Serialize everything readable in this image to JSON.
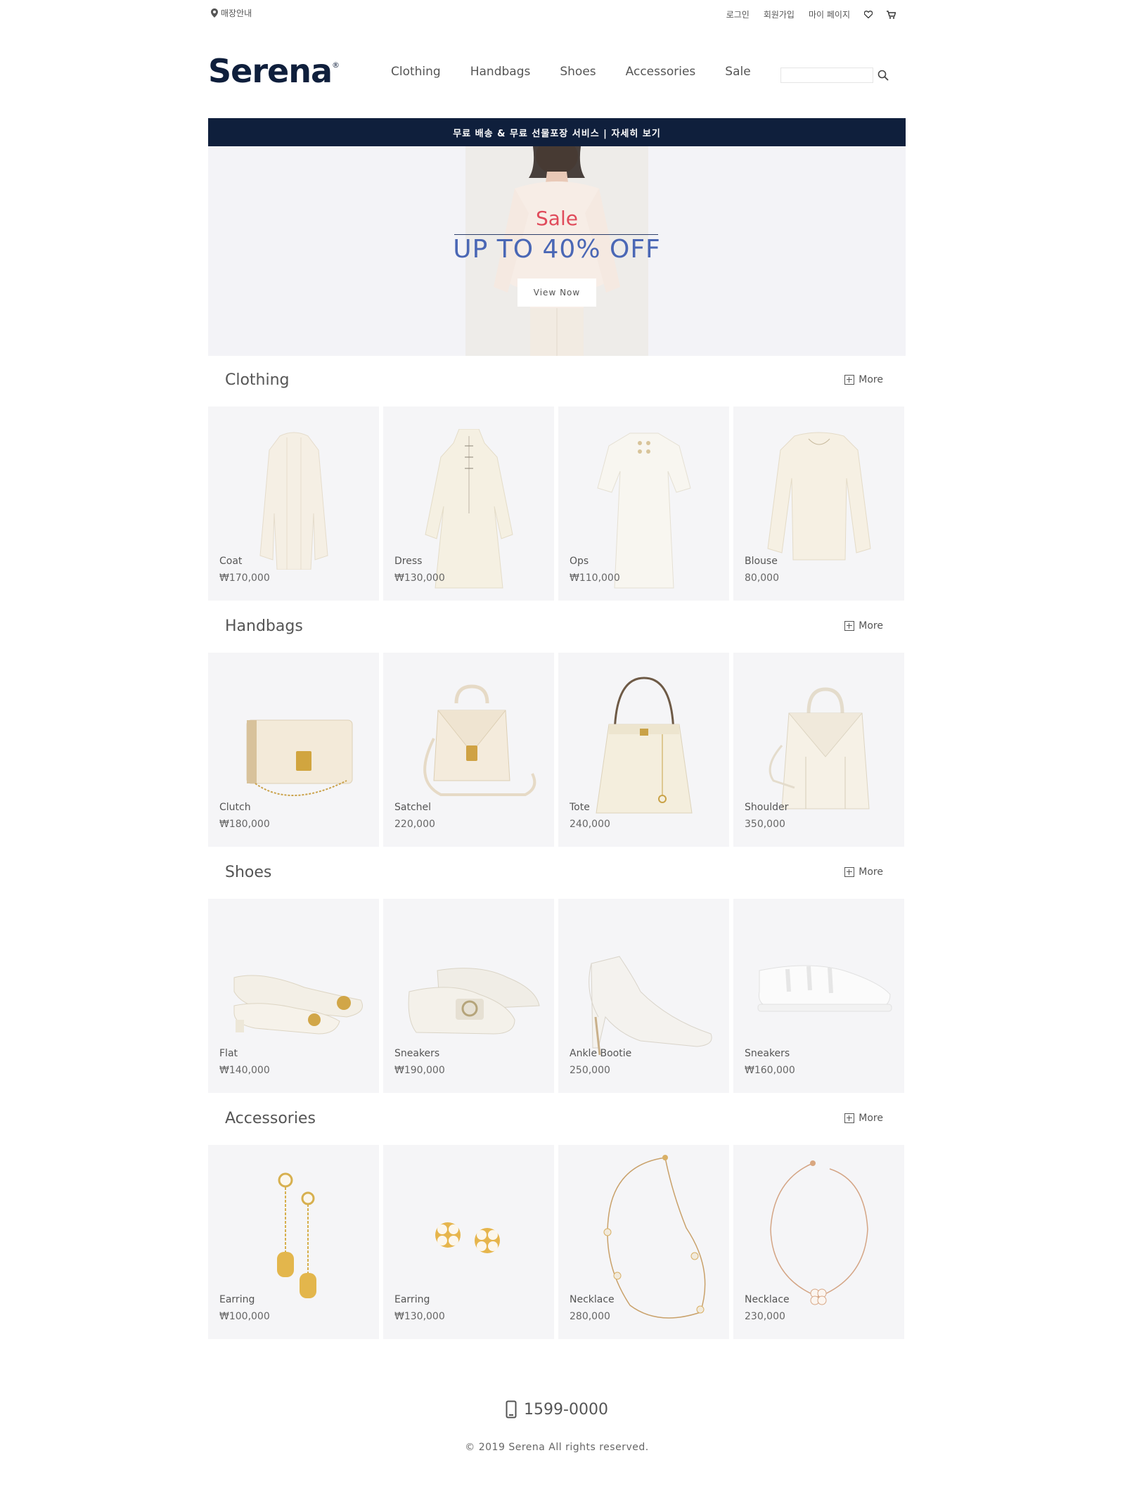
{
  "util": {
    "store": "매장안내",
    "login": "로그인",
    "join": "회원가입",
    "mypage": "마이 페이지"
  },
  "header": {
    "logo": "Serena",
    "logo_mark": "®",
    "nav": [
      "Clothing",
      "Handbags",
      "Shoes",
      "Accessories",
      "Sale"
    ],
    "search_placeholder": ""
  },
  "notice": "무료 배송 & 무료 선물포장 서비스 | 자세히 보기",
  "hero": {
    "sale": "Sale",
    "headline": "UP TO 40% OFF",
    "button": "View Now"
  },
  "more_label": "More",
  "sections": [
    {
      "title": "Clothing",
      "items": [
        {
          "name": "Coat",
          "price": "₩170,000"
        },
        {
          "name": "Dress",
          "price": "₩130,000"
        },
        {
          "name": "Ops",
          "price": "₩110,000"
        },
        {
          "name": "Blouse",
          "price": "80,000"
        }
      ]
    },
    {
      "title": "Handbags",
      "items": [
        {
          "name": "Clutch",
          "price": "₩180,000"
        },
        {
          "name": "Satchel",
          "price": "220,000"
        },
        {
          "name": "Tote",
          "price": "240,000"
        },
        {
          "name": "Shoulder",
          "price": "350,000"
        }
      ]
    },
    {
      "title": "Shoes",
      "items": [
        {
          "name": "Flat",
          "price": "₩140,000"
        },
        {
          "name": "Sneakers",
          "price": "₩190,000"
        },
        {
          "name": "Ankle Bootie",
          "price": "250,000"
        },
        {
          "name": "Sneakers",
          "price": "₩160,000"
        }
      ]
    },
    {
      "title": "Accessories",
      "items": [
        {
          "name": "Earring",
          "price": "₩100,000"
        },
        {
          "name": "Earring",
          "price": "₩130,000"
        },
        {
          "name": "Necklace",
          "price": "280,000"
        },
        {
          "name": "Necklace",
          "price": "230,000"
        }
      ]
    }
  ],
  "footer": {
    "phone": "1599-0000",
    "copyright": "© 2019 Serena All rights reserved."
  },
  "colors": {
    "navy": "#0f1f3c",
    "sale_red": "#e04b5b",
    "headline_blue": "#4a67b5",
    "card_bg": "#f5f5f7"
  }
}
